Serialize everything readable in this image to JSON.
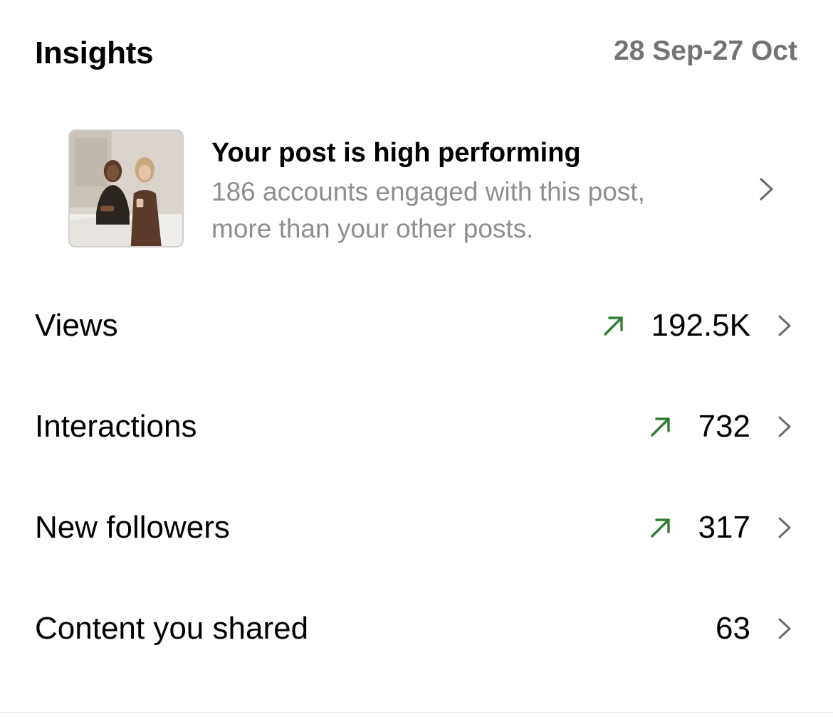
{
  "header": {
    "title": "Insights",
    "date_range": "28 Sep-27 Oct"
  },
  "post_card": {
    "headline": "Your post is high performing",
    "description": "186 accounts engaged with this post, more than your other posts.",
    "thumbnail_icon": "post-thumbnail-image",
    "chevron_icon": "chevron-right-icon"
  },
  "metrics": [
    {
      "label": "Views",
      "value": "192.5K",
      "trend": "up"
    },
    {
      "label": "Interactions",
      "value": "732",
      "trend": "up"
    },
    {
      "label": "New followers",
      "value": "317",
      "trend": "up"
    },
    {
      "label": "Content you shared",
      "value": "63",
      "trend": ""
    }
  ],
  "colors": {
    "trend_up": "#2e7d32",
    "secondary_text": "#8e8e8e",
    "date_text": "#737373",
    "chevron": "#8e8e8e"
  }
}
